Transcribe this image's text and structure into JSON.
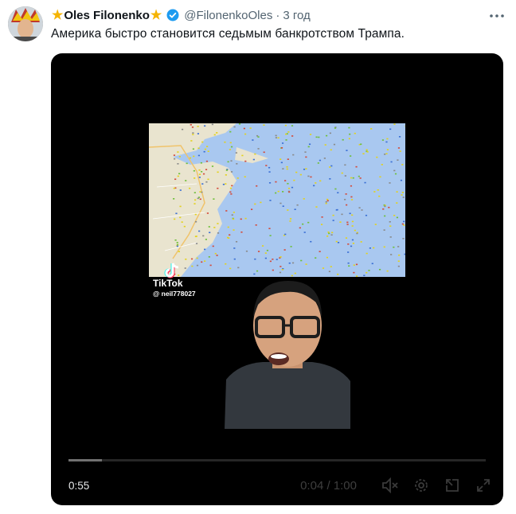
{
  "tweet": {
    "author_name": "Oles Filonenko",
    "star_glyph": "★",
    "handle": "@FilonenkoOles",
    "separator": "·",
    "time": "3 год",
    "text": "Америка быстро становится седьмым банкротством Трампа."
  },
  "video": {
    "watermark_brand": "TikTok",
    "watermark_user": "@ neil778027",
    "remaining_time": "0:55",
    "timecode": "0:04 / 1:00",
    "progress_fraction": 0.08
  },
  "colors": {
    "star": "#f5b400",
    "verified": "#1d9bf0",
    "secondary_text": "#536471",
    "map_water": "#a9c8f0",
    "map_land": "#e9e4cf"
  }
}
